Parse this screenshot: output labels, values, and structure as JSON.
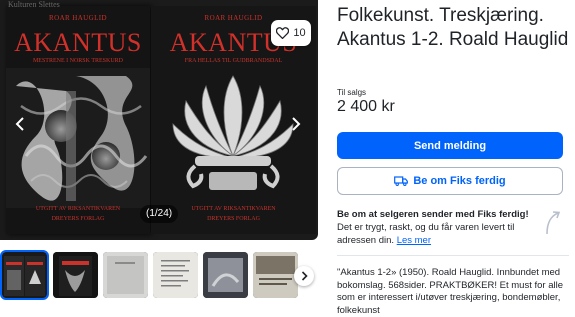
{
  "gallery": {
    "watermark": "Kulturen Slettes",
    "books": [
      {
        "author": "ROAR HAUGLID",
        "title": "AKANTUS",
        "subtitle": "MESTRENE I NORSK TRESKURD",
        "series": "UTGITT AV RIKSANTIKVAREN",
        "publisher": "DREYERS FORLAG"
      },
      {
        "author": "ROAR HAUGLID",
        "title": "AKANTUS",
        "subtitle": "FRA HELLAS TIL GUDBRANDSDAL",
        "series": "UTGITT AV RIKSANTIKVAREN",
        "publisher": "DREYERS FORLAG"
      }
    ],
    "favorite": {
      "icon": "heart-icon",
      "count": "10"
    },
    "prev_icon": "chevron-left-icon",
    "next_icon": "chevron-right-icon",
    "counter": "(1/24)"
  },
  "thumbnails": {
    "count_shown": 6,
    "active_index": 0,
    "next_icon": "chevron-right-icon"
  },
  "listing": {
    "title": "Folkekunst. Treskjæring. Akantus 1-2. Roald Hauglid",
    "status_label": "Til salgs",
    "price": "2 400 kr",
    "primary_button": "Send melding",
    "secondary_button": "Be om Fiks ferdig",
    "secondary_icon": "truck-icon",
    "fiks_text_bold": "Be om at selgeren sender med Fiks ferdig!",
    "fiks_text_rest": " Det er trygt, raskt, og du får varen levert til adressen din. ",
    "fiks_link": "Les mer",
    "description": "\"Akantus 1-2» (1950). Roald Hauglid. Innbundet med bokomslag. 568sider. PRAKTBØKER! Et must for alle som er interessert i/utøver treskjæring, bondemøbler, folkekunst"
  },
  "colors": {
    "accent": "#0063fb",
    "title_red": "#d2302a",
    "text": "#1f2328"
  }
}
